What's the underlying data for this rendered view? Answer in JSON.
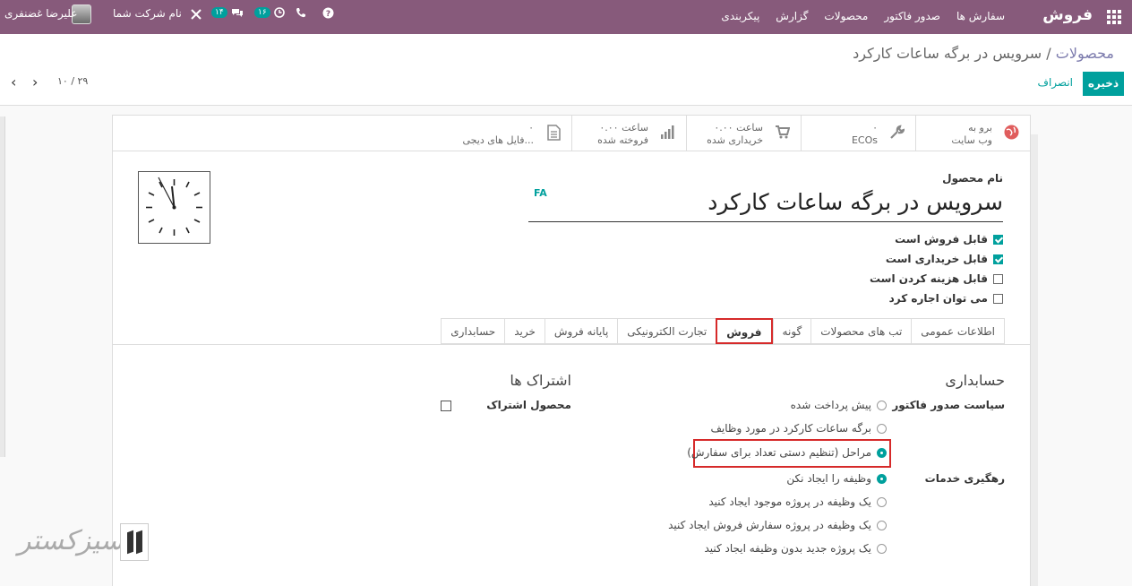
{
  "navbar": {
    "app_name": "فروش",
    "menu": [
      "سفارش ها",
      "صدور فاکتور",
      "محصولات",
      "گزارش",
      "پیکربندی"
    ],
    "activity_count": "۱۶",
    "messages_count": "۱۴",
    "company_name": "نام شرکت شما",
    "user_name": "علیرضا غضنفری"
  },
  "control_panel": {
    "breadcrumb_parent": "محصولات",
    "breadcrumb_sep": "/",
    "breadcrumb_current": "سرویس در برگه ساعات کارکرد",
    "save_label": "ذخیره",
    "discard_label": "انصراف",
    "pager": "۱۰ / ۲۹"
  },
  "smart_buttons": [
    {
      "icon": "globe-icon",
      "line1": "برو به",
      "line2": "وب سایت"
    },
    {
      "icon": "wrench-icon",
      "line1": "۰",
      "line2": "ECOs"
    },
    {
      "icon": "cart-icon",
      "line1": "۰.۰۰ ساعت",
      "line2": "خریداری شده"
    },
    {
      "icon": "bar-chart-icon",
      "line1": "۰.۰۰ ساعت",
      "line2": "فروخته شده"
    },
    {
      "icon": "file-icon",
      "line1": "۰",
      "line2": "فایل های دیجی..."
    }
  ],
  "product": {
    "name_label": "نام محصول",
    "name": "سرویس در برگه ساعات کارکرد",
    "lang": "FA",
    "checkboxes": [
      {
        "label": "قابل فروش است",
        "checked": true
      },
      {
        "label": "قابل خریداری است",
        "checked": true
      },
      {
        "label": "قابل هزینه کردن است",
        "checked": false
      },
      {
        "label": "می توان اجاره کرد",
        "checked": false
      }
    ]
  },
  "tabs": [
    "اطلاعات عمومی",
    "تب های محصولات",
    "گونه",
    "فروش",
    "تجارت الکترونیکی",
    "پایانه فروش",
    "خرید",
    "حسابداری"
  ],
  "active_tab": "فروش",
  "sales_tab": {
    "accounting_title": "حسابداری",
    "subscriptions_title": "اشتراک ها",
    "invoice_policy_label": "سیاست صدور فاکتور",
    "invoice_policy_options": [
      {
        "label": "پیش پرداخت شده",
        "checked": false
      },
      {
        "label": "برگه ساعات کارکرد در مورد وظایف",
        "checked": false
      },
      {
        "label": "مراحل (تنظیم دستی تعداد برای سفارش)",
        "checked": true
      }
    ],
    "service_tracking_label": "رهگیری خدمات",
    "service_tracking_options": [
      {
        "label": "وظیفه را ایجاد نکن",
        "checked": true
      },
      {
        "label": "یک وظیفه در پروژه موجود ایجاد کنید",
        "checked": false
      },
      {
        "label": "یک وظیفه در پروژه سفارش فروش ایجاد کنید",
        "checked": false
      },
      {
        "label": "یک پروژه جدید بدون وظیفه ایجاد کنید",
        "checked": false
      }
    ],
    "subscription_product_label": "محصول اشتراک"
  },
  "watermark": "تیسیزکستر",
  "colors": {
    "navbar": "#875a7b",
    "primary": "#00a09d",
    "highlight": "#d62a2a"
  }
}
